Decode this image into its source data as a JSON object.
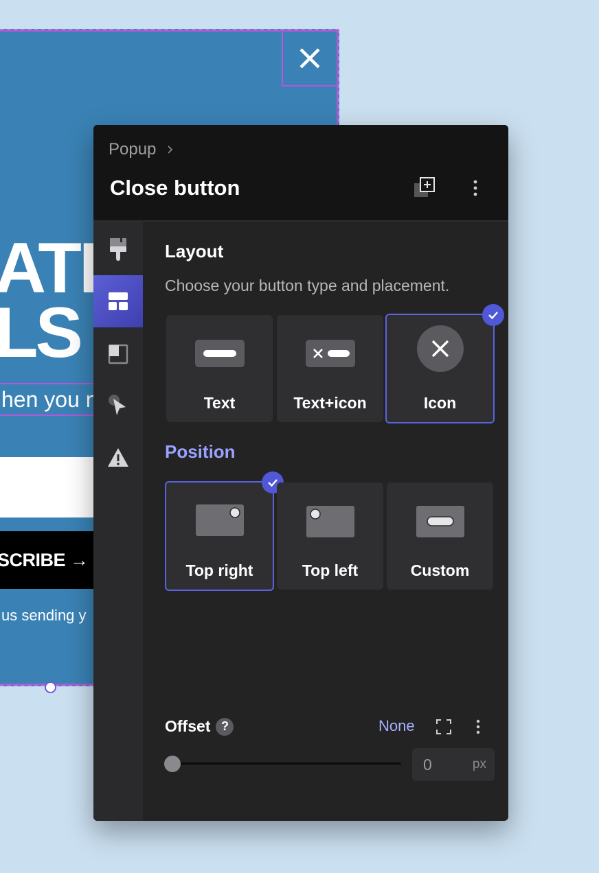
{
  "preview": {
    "headline": "ATI\nLS",
    "subtitle": "hen you n",
    "subscribe_label": "SCRIBE →",
    "footnote": "us sending y"
  },
  "panel": {
    "breadcrumb": "Popup",
    "title": "Close button"
  },
  "sidebar": {
    "items": [
      {
        "icon": "paintbrush-icon"
      },
      {
        "icon": "layout-icon",
        "active": true
      },
      {
        "icon": "layers-icon"
      },
      {
        "icon": "cursor-icon"
      },
      {
        "icon": "warning-icon"
      }
    ]
  },
  "layout": {
    "title": "Layout",
    "description": "Choose your button type and placement.",
    "options": [
      {
        "label": "Text",
        "selected": false
      },
      {
        "label": "Text+icon",
        "selected": false
      },
      {
        "label": "Icon",
        "selected": true
      }
    ]
  },
  "position": {
    "title": "Position",
    "options": [
      {
        "label": "Top right",
        "selected": true
      },
      {
        "label": "Top left",
        "selected": false
      },
      {
        "label": "Custom",
        "selected": false
      }
    ]
  },
  "offset": {
    "label": "Offset",
    "help": "?",
    "mode": "None",
    "value": "0",
    "unit": "px"
  },
  "colors": {
    "accent": "#5b63e0",
    "accent_text": "#9aa2ff",
    "panel_bg": "#232324",
    "header_bg": "#141414",
    "canvas_bg": "#cadff0",
    "popup_bg": "#3a82b5"
  }
}
